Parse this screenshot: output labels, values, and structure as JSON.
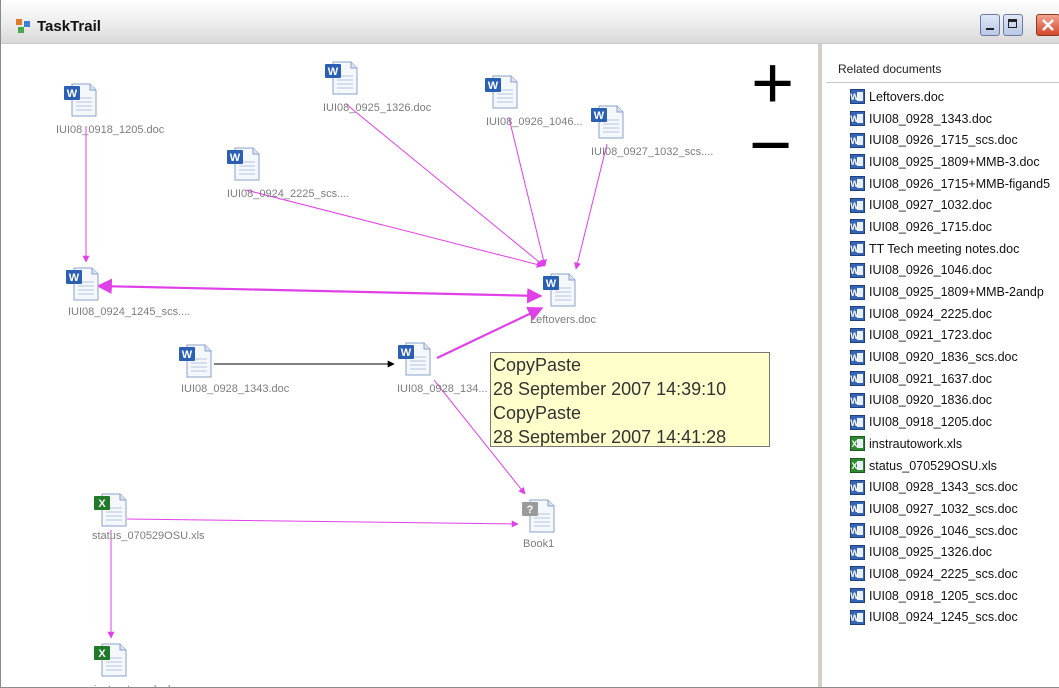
{
  "window": {
    "title": "TaskTrail"
  },
  "zoom": {
    "zoom_in_label": "+",
    "zoom_out_label": "−"
  },
  "graph": {
    "nodes": [
      {
        "id": "n1",
        "label": "IUI08_0918_1205.doc",
        "type": "word"
      },
      {
        "id": "n2",
        "label": "IUI08_0925_1326.doc",
        "type": "word"
      },
      {
        "id": "n3",
        "label": "IUI08_0926_1046...",
        "type": "word"
      },
      {
        "id": "n4",
        "label": "IUI08_0927_1032_scs....",
        "type": "word"
      },
      {
        "id": "n5",
        "label": "IUI08_0924_2225_scs....",
        "type": "word"
      },
      {
        "id": "n6",
        "label": "IUI08_0924_1245_scs....",
        "type": "word"
      },
      {
        "id": "n7",
        "label": "Leftovers.doc",
        "type": "word"
      },
      {
        "id": "n8",
        "label": "IUI08_0928_1343.doc",
        "type": "word"
      },
      {
        "id": "n9",
        "label": "IUI08_0928_134...",
        "type": "word"
      },
      {
        "id": "n10",
        "label": "status_070529OSU.xls",
        "type": "excel"
      },
      {
        "id": "n11",
        "label": "Book1",
        "type": "generic"
      },
      {
        "id": "n12",
        "label": "instrautowork.xls",
        "type": "excel"
      }
    ],
    "edges": [
      {
        "from": "n1",
        "to": "n6",
        "kind": "copy"
      },
      {
        "from": "n2",
        "to": "n7",
        "kind": "copy"
      },
      {
        "from": "n3",
        "to": "n7",
        "kind": "copy"
      },
      {
        "from": "n4",
        "to": "n7",
        "kind": "copy"
      },
      {
        "from": "n5",
        "to": "n7",
        "kind": "copy"
      },
      {
        "from": "n6",
        "to": "n7",
        "kind": "copy-bidirectional"
      },
      {
        "from": "n8",
        "to": "n9",
        "kind": "open"
      },
      {
        "from": "n9",
        "to": "n7",
        "kind": "copy"
      },
      {
        "from": "n9",
        "to": "n11",
        "kind": "copy"
      },
      {
        "from": "n10",
        "to": "n11",
        "kind": "copy"
      },
      {
        "from": "n10",
        "to": "n12",
        "kind": "copy"
      }
    ],
    "colors": {
      "copy_edge": "#e040e8",
      "open_edge": "#000000",
      "label": "#7d7d7d"
    }
  },
  "tooltip": {
    "lines": [
      "CopyPaste",
      "28 September 2007 14:39:10",
      "CopyPaste",
      "28 September 2007 14:41:28"
    ]
  },
  "sidebar": {
    "header": "Related documents",
    "items": [
      {
        "label": "Leftovers.doc",
        "icon": "word-icon"
      },
      {
        "label": "IUI08_0928_1343.doc",
        "icon": "word-icon"
      },
      {
        "label": "IUI08_0926_1715_scs.doc",
        "icon": "word-icon"
      },
      {
        "label": "IUI08_0925_1809+MMB-3.doc",
        "icon": "word-icon"
      },
      {
        "label": "IUI08_0926_1715+MMB-figand5",
        "icon": "word-icon"
      },
      {
        "label": "IUI08_0927_1032.doc",
        "icon": "word-icon"
      },
      {
        "label": "IUI08_0926_1715.doc",
        "icon": "word-icon"
      },
      {
        "label": "TT Tech meeting notes.doc",
        "icon": "word-icon"
      },
      {
        "label": "IUI08_0926_1046.doc",
        "icon": "word-icon"
      },
      {
        "label": "IUI08_0925_1809+MMB-2andp",
        "icon": "word-icon"
      },
      {
        "label": "IUI08_0924_2225.doc",
        "icon": "word-icon"
      },
      {
        "label": "IUI08_0921_1723.doc",
        "icon": "word-icon"
      },
      {
        "label": "IUI08_0920_1836_scs.doc",
        "icon": "word-icon"
      },
      {
        "label": "IUI08_0921_1637.doc",
        "icon": "word-icon"
      },
      {
        "label": "IUI08_0920_1836.doc",
        "icon": "word-icon"
      },
      {
        "label": "IUI08_0918_1205.doc",
        "icon": "word-icon"
      },
      {
        "label": "instrautowork.xls",
        "icon": "excel-icon"
      },
      {
        "label": "status_070529OSU.xls",
        "icon": "excel-icon"
      },
      {
        "label": "IUI08_0928_1343_scs.doc",
        "icon": "word-icon"
      },
      {
        "label": "IUI08_0927_1032_scs.doc",
        "icon": "word-icon"
      },
      {
        "label": "IUI08_0926_1046_scs.doc",
        "icon": "word-icon"
      },
      {
        "label": "IUI08_0925_1326.doc",
        "icon": "word-icon"
      },
      {
        "label": "IUI08_0924_2225_scs.doc",
        "icon": "word-icon"
      },
      {
        "label": "IUI08_0918_1205_scs.doc",
        "icon": "word-icon"
      },
      {
        "label": "IUI08_0924_1245_scs.doc",
        "icon": "word-icon"
      }
    ]
  }
}
